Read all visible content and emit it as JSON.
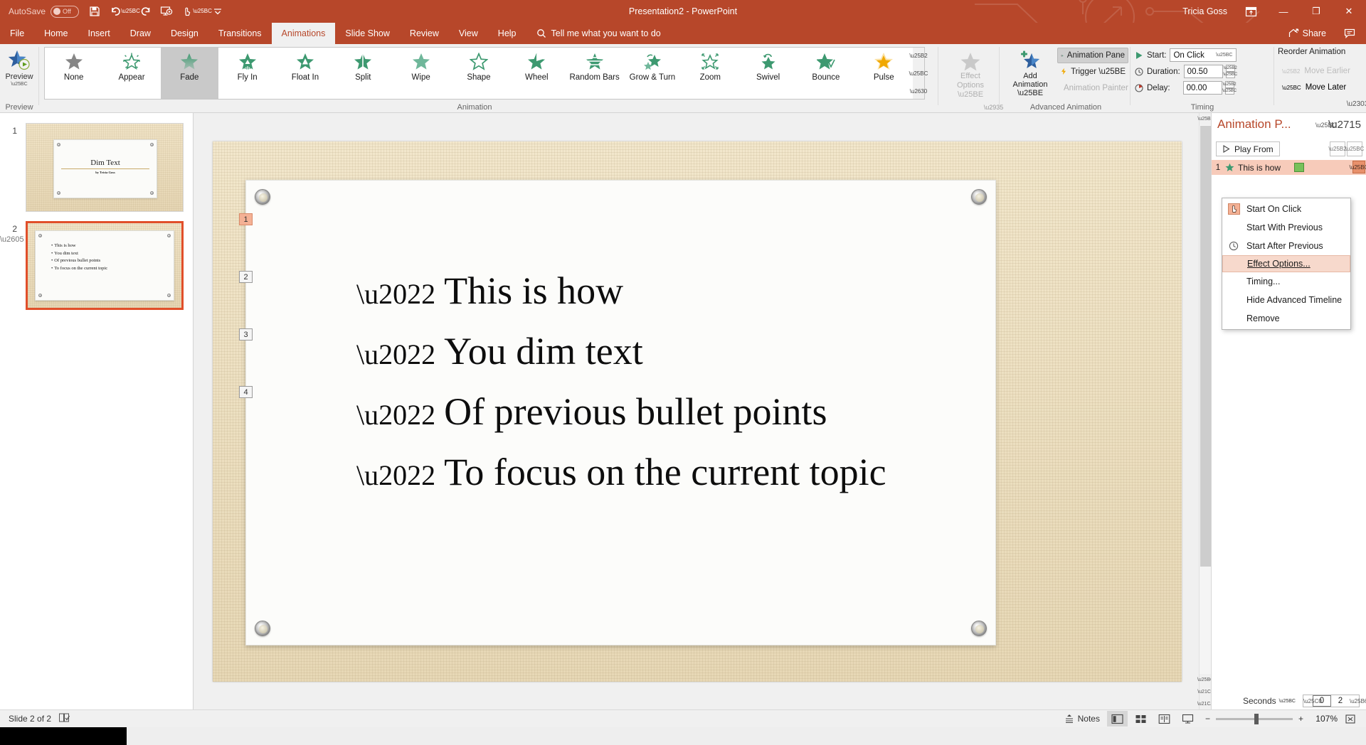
{
  "titlebar": {
    "autosave_label": "AutoSave",
    "autosave_state": "Off",
    "doc_title": "Presentation2  -  PowerPoint",
    "user": "Tricia Goss",
    "quick_access": [
      "save-icon",
      "undo-icon",
      "redo-icon",
      "start-from-beginning-icon",
      "touch-mouse-mode-icon",
      "customize-qat-icon"
    ],
    "ribbon_display_icon": "ribbon-display-options-icon",
    "minimize": "—",
    "restore": "❐",
    "close": "✕"
  },
  "tabs": [
    {
      "label": "File",
      "active": false
    },
    {
      "label": "Home",
      "active": false
    },
    {
      "label": "Insert",
      "active": false
    },
    {
      "label": "Draw",
      "active": false
    },
    {
      "label": "Design",
      "active": false
    },
    {
      "label": "Transitions",
      "active": false
    },
    {
      "label": "Animations",
      "active": true
    },
    {
      "label": "Slide Show",
      "active": false
    },
    {
      "label": "Review",
      "active": false
    },
    {
      "label": "View",
      "active": false
    },
    {
      "label": "Help",
      "active": false
    }
  ],
  "tellme": {
    "placeholder": "Tell me what you want to do"
  },
  "share": {
    "label": "Share",
    "comments_icon": "comments-icon"
  },
  "ribbon": {
    "preview": {
      "button_label": "Preview",
      "group_label": "Preview"
    },
    "animation": {
      "group_label": "Animation",
      "items": [
        {
          "label": "None",
          "style": "none",
          "selected": false
        },
        {
          "label": "Appear",
          "style": "appear",
          "selected": false
        },
        {
          "label": "Fade",
          "style": "fade",
          "selected": true
        },
        {
          "label": "Fly In",
          "style": "flyin",
          "selected": false
        },
        {
          "label": "Float In",
          "style": "floatin",
          "selected": false
        },
        {
          "label": "Split",
          "style": "split",
          "selected": false
        },
        {
          "label": "Wipe",
          "style": "wipe",
          "selected": false
        },
        {
          "label": "Shape",
          "style": "shape",
          "selected": false
        },
        {
          "label": "Wheel",
          "style": "wheel",
          "selected": false
        },
        {
          "label": "Random Bars",
          "style": "randombars",
          "selected": false
        },
        {
          "label": "Grow & Turn",
          "style": "growturn",
          "selected": false
        },
        {
          "label": "Zoom",
          "style": "zoom",
          "selected": false
        },
        {
          "label": "Swivel",
          "style": "swivel",
          "selected": false
        },
        {
          "label": "Bounce",
          "style": "bounce",
          "selected": false
        },
        {
          "label": "Pulse",
          "style": "pulse",
          "selected": false
        }
      ]
    },
    "effect_options": {
      "line1": "Effect",
      "line2": "Options",
      "disabled": true
    },
    "advanced": {
      "group_label": "Advanced Animation",
      "add_animation_line1": "Add",
      "add_animation_line2": "Animation",
      "animation_pane_label": "Animation Pane",
      "trigger_label": "Trigger",
      "animation_painter_label": "Animation Painter"
    },
    "timing": {
      "group_label": "Timing",
      "start_label": "Start:",
      "start_value": "On Click",
      "duration_label": "Duration:",
      "duration_value": "00.50",
      "delay_label": "Delay:",
      "delay_value": "00.00"
    },
    "reorder": {
      "title": "Reorder Animation",
      "move_earlier": "Move Earlier",
      "move_later": "Move Later"
    }
  },
  "thumbnails": [
    {
      "number": "1",
      "selected": false,
      "has_anim_star": false,
      "title": "Dim Text",
      "subtitle": "by Tricia Goss",
      "bullets": []
    },
    {
      "number": "2",
      "selected": true,
      "has_anim_star": true,
      "title": "",
      "subtitle": "",
      "bullets": [
        "This is how",
        "You dim text",
        "Of previous bullet points",
        "To focus on the current topic"
      ]
    }
  ],
  "slide": {
    "bullets": [
      {
        "tag": "1",
        "text": "This is how",
        "tag_active": true
      },
      {
        "tag": "2",
        "text": "You dim text",
        "tag_active": false
      },
      {
        "tag": "3",
        "text": "Of previous bullet points",
        "tag_active": false
      },
      {
        "tag": "4",
        "text": "To focus on the current topic",
        "tag_active": false
      }
    ]
  },
  "animation_pane": {
    "title": "Animation P...",
    "play_from": "Play From",
    "items": [
      {
        "index": "1",
        "label": "This is how",
        "effect_icon": "fade-star-icon"
      }
    ],
    "context_menu": [
      {
        "label": "Start On Click",
        "underline": "C",
        "icon": "mouse-click-icon",
        "highlight": false
      },
      {
        "label": "Start With Previous",
        "underline": "W",
        "icon": "",
        "highlight": false
      },
      {
        "label": "Start After Previous",
        "underline": "A",
        "icon": "clock-icon",
        "highlight": false
      },
      {
        "label": "Effect Options...",
        "underline": "E",
        "icon": "",
        "highlight": true
      },
      {
        "label": "Timing...",
        "underline": "T",
        "icon": "",
        "highlight": false
      },
      {
        "label": "Hide Advanced Timeline",
        "underline": "H",
        "icon": "",
        "highlight": false
      },
      {
        "label": "Remove",
        "underline": "R",
        "icon": "",
        "highlight": false
      }
    ],
    "seconds_label": "Seconds",
    "scale_start": "0",
    "scale_end": "2"
  },
  "statusbar": {
    "slide_counter": "Slide 2 of 2",
    "accessibility_icon": "accessibility-checker-icon",
    "notes_label": "Notes",
    "views": [
      "normal-view-icon",
      "slide-sorter-icon",
      "reading-view-icon",
      "slideshow-icon"
    ],
    "zoom_minus": "−",
    "zoom_plus": "+",
    "zoom_percent": "107%",
    "fit_icon": "fit-slide-icon"
  },
  "colors": {
    "brand": "#b7472a",
    "accent_star": "#3d9970",
    "selection": "#e14f2a",
    "pane_highlight": "#f7cbba",
    "timeline_bar": "#77c159"
  }
}
